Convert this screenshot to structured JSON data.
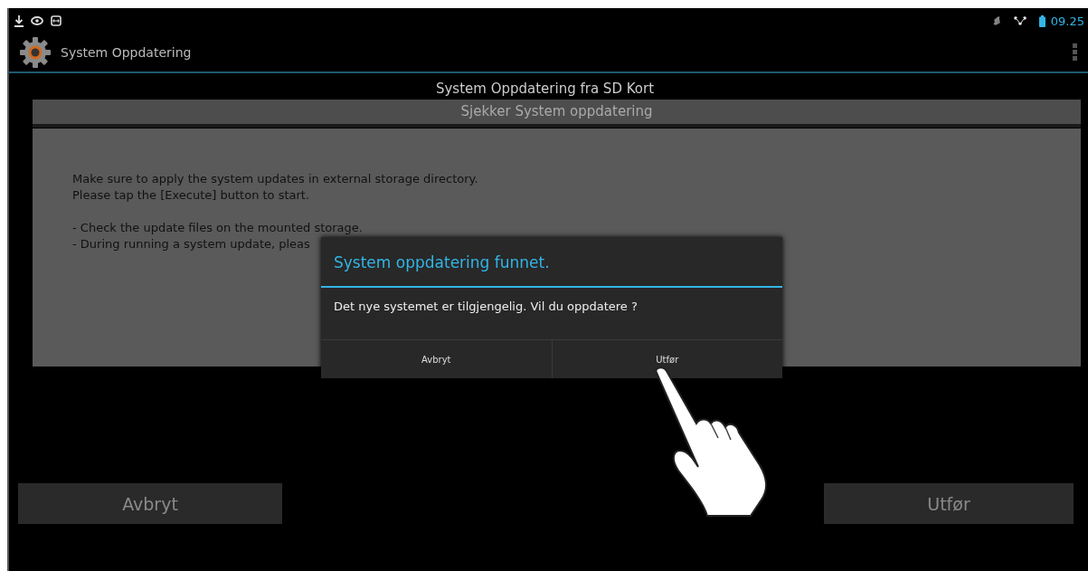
{
  "status_bar": {
    "time": "09.25"
  },
  "action_bar": {
    "title": "System Oppdatering"
  },
  "screen_title": "System Oppdatering fra SD Kort",
  "header": "Sjekker System oppdatering",
  "instructions": [
    [
      "Make sure to apply the system updates in external storage directory.",
      "Please tap the [Execute] button to start."
    ],
    [
      "- Check the update files on the mounted storage.",
      "- During running a system update, pleas"
    ]
  ],
  "buttons": [
    {
      "label": "Avbryt"
    },
    {
      "label": "Utfør"
    }
  ],
  "dialog": {
    "title": "System oppdatering funnet.",
    "message": "Det nye systemet er tilgjengelig. Vil du oppdatere ?",
    "buttons": [
      {
        "label": "Avbryt"
      },
      {
        "label": "Utfør"
      }
    ]
  }
}
